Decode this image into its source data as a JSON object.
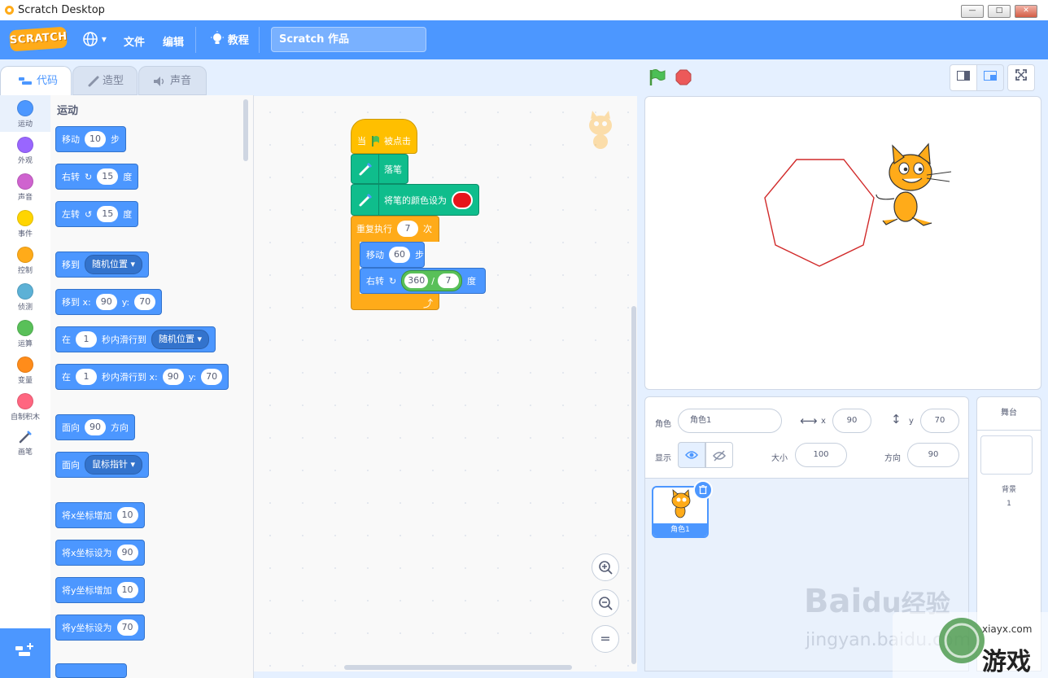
{
  "window": {
    "title": "Scratch Desktop",
    "min": "—",
    "max": "□",
    "close": "✕"
  },
  "menu": {
    "logo": "SCRATCH",
    "lang_arrow": "▾",
    "file": "文件",
    "edit": "编辑",
    "tutorials": "教程",
    "project_name": "Scratch 作品"
  },
  "tabs": {
    "code": "代码",
    "costumes": "造型",
    "sounds": "声音"
  },
  "categories": [
    {
      "label": "运动",
      "color": "#4c97ff"
    },
    {
      "label": "外观",
      "color": "#9966ff"
    },
    {
      "label": "声音",
      "color": "#cf63cf"
    },
    {
      "label": "事件",
      "color": "#ffd500"
    },
    {
      "label": "控制",
      "color": "#ffab19"
    },
    {
      "label": "侦测",
      "color": "#5cb1d6"
    },
    {
      "label": "运算",
      "color": "#59c059"
    },
    {
      "label": "变量",
      "color": "#ff8c1a"
    },
    {
      "label": "自制积木",
      "color": "#ff6680"
    },
    {
      "label": "画笔",
      "color": "#0fbd8c"
    }
  ],
  "palette": {
    "title": "运动",
    "move": {
      "a": "移动",
      "n": "10",
      "b": "步"
    },
    "turn_right": {
      "a": "右转",
      "n": "15",
      "b": "度"
    },
    "turn_left": {
      "a": "左转",
      "n": "15",
      "b": "度"
    },
    "goto": {
      "a": "移到",
      "dd": "随机位置 ▾"
    },
    "goto_xy": {
      "a": "移到 x:",
      "x": "90",
      "yl": "y:",
      "y": "70"
    },
    "glide": {
      "a": "在",
      "n": "1",
      "b": "秒内滑行到",
      "dd": "随机位置 ▾"
    },
    "glide_xy": {
      "a": "在",
      "n": "1",
      "b": "秒内滑行到 x:",
      "x": "90",
      "yl": "y:",
      "y": "70"
    },
    "point": {
      "a": "面向",
      "n": "90",
      "b": "方向"
    },
    "point_to": {
      "a": "面向",
      "dd": "鼠标指针 ▾"
    },
    "change_x": {
      "a": "将x坐标增加",
      "n": "10"
    },
    "set_x": {
      "a": "将x坐标设为",
      "n": "90"
    },
    "change_y": {
      "a": "将y坐标增加",
      "n": "10"
    },
    "set_y": {
      "a": "将y坐标设为",
      "n": "70"
    }
  },
  "script": {
    "hat": {
      "a": "当",
      "b": "被点击"
    },
    "pen_down": "落笔",
    "set_pen_color": "将笔的颜色设为",
    "repeat": {
      "a": "重复执行",
      "n": "7",
      "b": "次"
    },
    "move": {
      "a": "移动",
      "n": "60",
      "b": "步"
    },
    "turn": {
      "a": "右转",
      "n1": "360",
      "op": "/",
      "n2": "7",
      "b": "度"
    },
    "loop_arrow": "⤴"
  },
  "zoom": {
    "in": "+",
    "out": "−",
    "reset": "="
  },
  "sprite_info": {
    "sprite_label": "角色",
    "sprite_name": "角色1",
    "x_label": "x",
    "x": "90",
    "y_label": "y",
    "y": "70",
    "show_label": "显示",
    "size_label": "大小",
    "size": "100",
    "direction_label": "方向",
    "direction": "90"
  },
  "sprites": [
    {
      "name": "角色1"
    }
  ],
  "stage_panel": {
    "title": "舞台",
    "backdrops_label": "背景",
    "backdrops_count": "1"
  },
  "watermark": {
    "baidu": "Bai",
    "du": "du",
    "jingyan": "经验",
    "url": "jingyan.baidu.com",
    "site": "xiayx.com",
    "game": "游戏"
  },
  "colors": {
    "accent": "#4c97ff",
    "pen": "#e6151b",
    "polygon": "#d12a2a"
  }
}
